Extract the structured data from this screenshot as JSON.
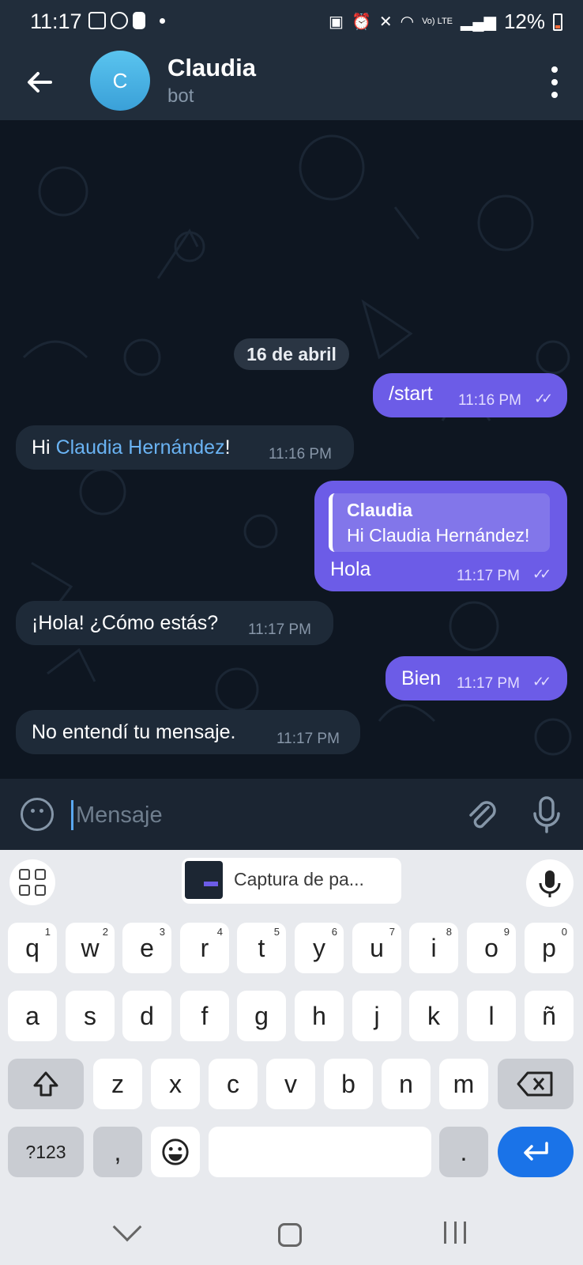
{
  "status_bar": {
    "time": "11:17",
    "battery": "12%",
    "signal_label": "Vo) LTE"
  },
  "header": {
    "avatar_letter": "C",
    "title": "Claudia",
    "subtitle": "bot"
  },
  "chat": {
    "date_chip": "16 de abril",
    "messages": [
      {
        "direction": "out",
        "text": "/start",
        "time": "11:16 PM",
        "read": true
      },
      {
        "direction": "in",
        "text_prefix": "Hi ",
        "mention": "Claudia Hernández",
        "text_suffix": "!",
        "time": "11:16 PM"
      },
      {
        "direction": "out",
        "reply_to_name": "Claudia",
        "reply_to_text": "Hi Claudia Hernández!",
        "text": "Hola",
        "time": "11:17 PM",
        "read": true
      },
      {
        "direction": "in",
        "text": "¡Hola! ¿Cómo estás?",
        "time": "11:17 PM"
      },
      {
        "direction": "out",
        "text": "Bien",
        "time": "11:17 PM",
        "read": true
      },
      {
        "direction": "in",
        "text": "No entendí tu mensaje.",
        "time": "11:17 PM"
      }
    ]
  },
  "input": {
    "placeholder": "Mensaje"
  },
  "keyboard": {
    "clipboard_label": "Captura de pa...",
    "row1": [
      "q",
      "w",
      "e",
      "r",
      "t",
      "y",
      "u",
      "i",
      "o",
      "p"
    ],
    "row1_hints": [
      "1",
      "2",
      "3",
      "4",
      "5",
      "6",
      "7",
      "8",
      "9",
      "0"
    ],
    "row2": [
      "a",
      "s",
      "d",
      "f",
      "g",
      "h",
      "j",
      "k",
      "l",
      "ñ"
    ],
    "row3": [
      "z",
      "x",
      "c",
      "v",
      "b",
      "n",
      "m"
    ],
    "symbols_label": "?123",
    "comma_label": ",",
    "period_label": "."
  },
  "colors": {
    "header_bg": "#212d3b",
    "chat_bg": "#0e1621",
    "outgoing_bubble": "#6c5ce7",
    "incoming_bubble": "#1e2a38",
    "mention_link": "#6ab3f3",
    "enter_key": "#1a73e8"
  },
  "icons": {
    "back": "arrow-left-icon",
    "menu": "kebab-menu-icon",
    "emoji": "smiley-icon",
    "attach": "paperclip-icon",
    "mic": "microphone-icon",
    "read_receipt": "double-check-icon"
  }
}
